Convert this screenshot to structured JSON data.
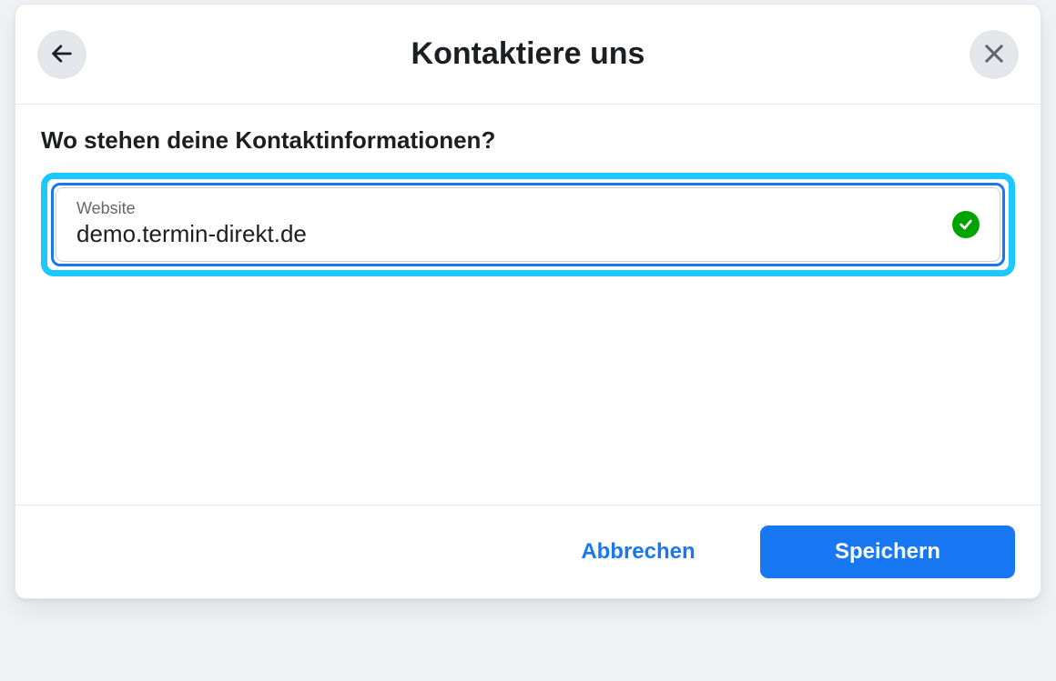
{
  "header": {
    "title": "Kontaktiere uns"
  },
  "body": {
    "section_label": "Wo stehen deine Kontaktinformationen?",
    "website_field": {
      "label": "Website",
      "value": "demo.termin-direkt.de"
    }
  },
  "footer": {
    "cancel_label": "Abbrechen",
    "save_label": "Speichern"
  }
}
